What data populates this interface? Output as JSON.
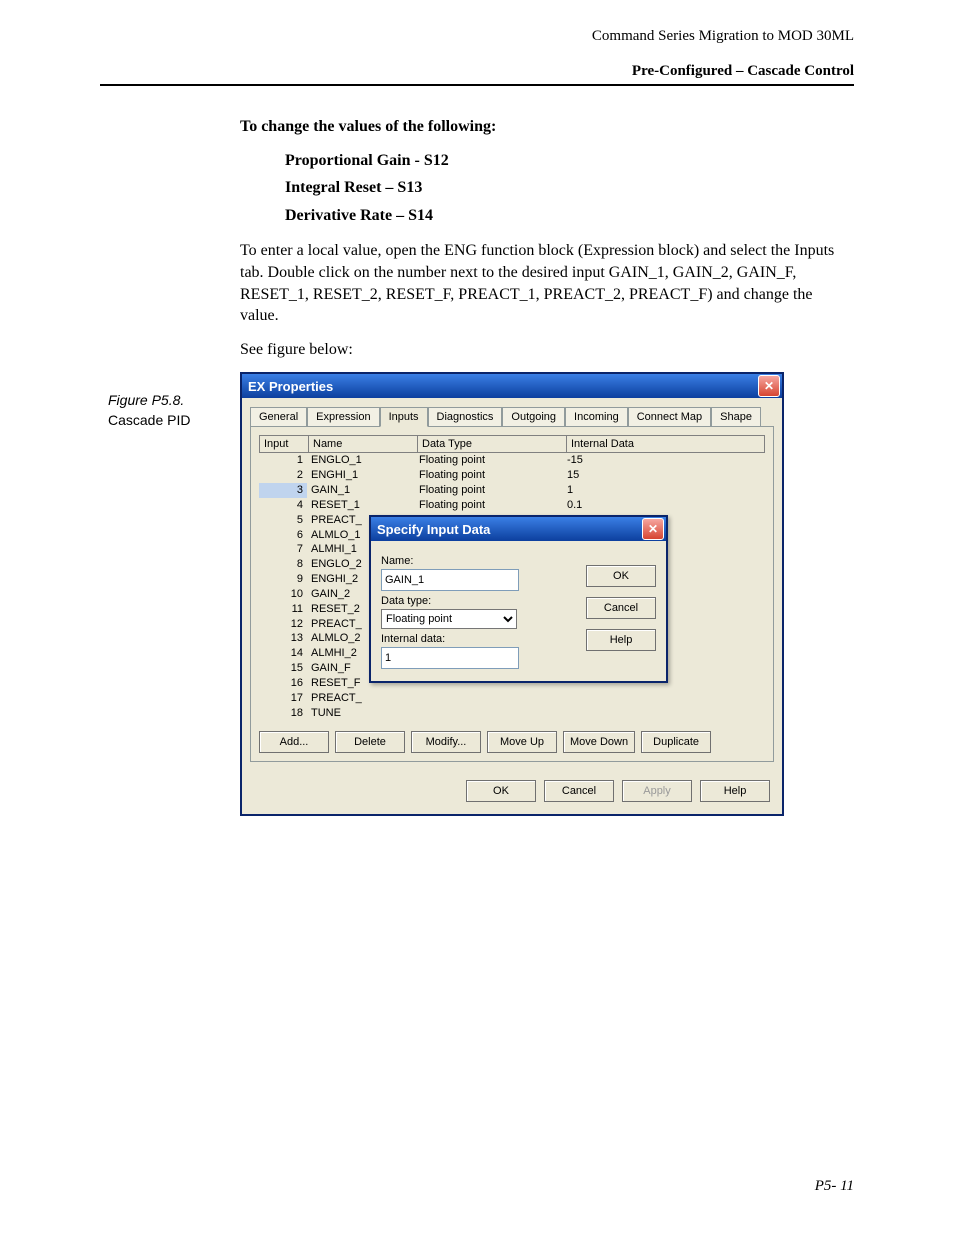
{
  "header": {
    "line1": "Command Series Migration to MOD 30ML",
    "line2": "Pre-Configured – Cascade Control"
  },
  "body": {
    "lead": "To change the values of the following:",
    "items": [
      "Proportional Gain - S12",
      "Integral Reset – S13",
      "Derivative Rate – S14"
    ],
    "para": "To enter a local value, open the ENG function block (Expression block) and select the Inputs tab. Double click on the number next to the desired input GAIN_1, GAIN_2, GAIN_F, RESET_1, RESET_2, RESET_F, PREACT_1, PREACT_2, PREACT_F) and change the value.",
    "see": "See figure below:"
  },
  "figure": {
    "num": "Figure P5.8.",
    "cap": "Cascade PID"
  },
  "win": {
    "title": "EX Properties",
    "tabs": [
      "General",
      "Expression",
      "Inputs",
      "Diagnostics",
      "Outgoing",
      "Incoming",
      "Connect Map",
      "Shape"
    ],
    "active_tab": 2,
    "grid": {
      "headers": [
        "Input",
        "Name",
        "Data Type",
        "Internal Data"
      ],
      "rows": [
        {
          "i": "1",
          "name": "ENGLO_1",
          "type": "Floating point",
          "data": "-15"
        },
        {
          "i": "2",
          "name": "ENGHI_1",
          "type": "Floating point",
          "data": "15"
        },
        {
          "i": "3",
          "name": "GAIN_1",
          "type": "Floating point",
          "data": "1",
          "sel": true
        },
        {
          "i": "4",
          "name": "RESET_1",
          "type": "Floating point",
          "data": "0.1"
        },
        {
          "i": "5",
          "name": "PREACT_",
          "type": "",
          "data": ""
        },
        {
          "i": "6",
          "name": "ALMLO_1",
          "type": "",
          "data": ""
        },
        {
          "i": "7",
          "name": "ALMHI_1",
          "type": "",
          "data": ""
        },
        {
          "i": "8",
          "name": "ENGLO_2",
          "type": "",
          "data": ""
        },
        {
          "i": "9",
          "name": "ENGHI_2",
          "type": "",
          "data": ""
        },
        {
          "i": "10",
          "name": "GAIN_2",
          "type": "",
          "data": ""
        },
        {
          "i": "11",
          "name": "RESET_2",
          "type": "",
          "data": ""
        },
        {
          "i": "12",
          "name": "PREACT_",
          "type": "",
          "data": ""
        },
        {
          "i": "13",
          "name": "ALMLO_2",
          "type": "",
          "data": ""
        },
        {
          "i": "14",
          "name": "ALMHI_2",
          "type": "",
          "data": ""
        },
        {
          "i": "15",
          "name": "GAIN_F",
          "type": "",
          "data": ""
        },
        {
          "i": "16",
          "name": "RESET_F",
          "type": "",
          "data": ""
        },
        {
          "i": "17",
          "name": "PREACT_",
          "type": "",
          "data": ""
        },
        {
          "i": "18",
          "name": "TUNE",
          "type": "",
          "data": ""
        }
      ]
    },
    "row_buttons": [
      "Add...",
      "Delete",
      "Modify...",
      "Move Up",
      "Move Down",
      "Duplicate"
    ],
    "footer_buttons": [
      "OK",
      "Cancel",
      "Apply",
      "Help"
    ],
    "footer_disabled": [
      false,
      false,
      true,
      false
    ]
  },
  "inner": {
    "title": "Specify Input Data",
    "name_label": "Name:",
    "name_value": "GAIN_1",
    "type_label": "Data type:",
    "type_value": "Floating point",
    "data_label": "Internal data:",
    "data_value": "1",
    "buttons": [
      "OK",
      "Cancel",
      "Help"
    ]
  },
  "page_num": "P5- 11"
}
